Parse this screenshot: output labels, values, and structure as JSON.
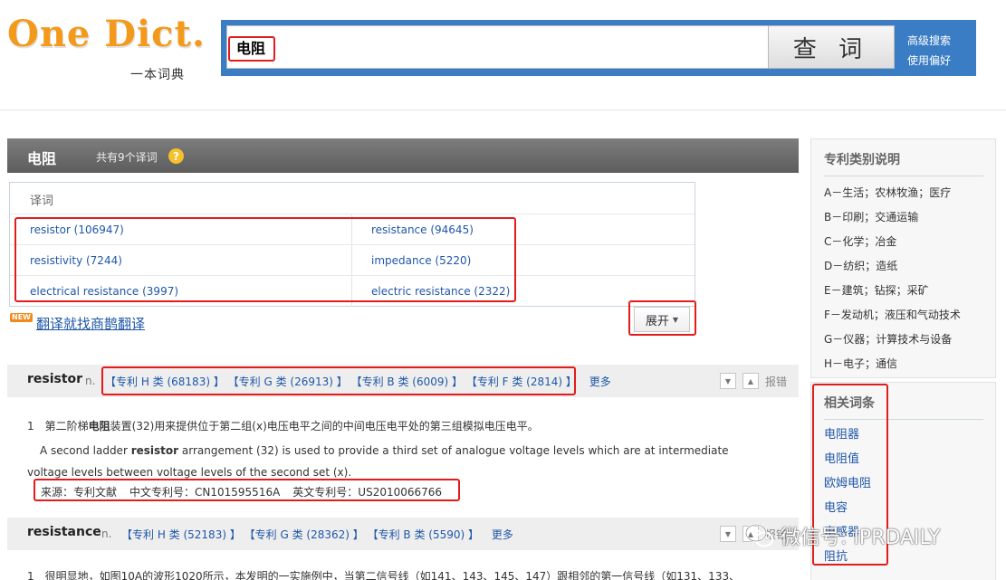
{
  "logo": {
    "main": "One Dict.",
    "sub": "一本词典"
  },
  "search": {
    "query": "电阻",
    "button_label": "查 词",
    "advanced": "高级搜索",
    "prefs": "使用偏好"
  },
  "word_panel": {
    "title": "电阻",
    "count_text": "共有9个译词",
    "help_icon": "?"
  },
  "translations": {
    "header": "译词",
    "rows": [
      {
        "left": "resistor (106947)",
        "right": "resistance (94645)"
      },
      {
        "left": "resistivity (7244)",
        "right": "impedance (5220)"
      },
      {
        "left": "electrical resistance (3997)",
        "right": "electric resistance (2322)"
      }
    ],
    "expand_label": "展开"
  },
  "promo": {
    "badge": "NEW",
    "text": "翻译就找商鹊翻译"
  },
  "entries": [
    {
      "word": "resistor",
      "pos": "n.",
      "categories": [
        "【专利 H 类 (68183) 】",
        "【专利 G 类 (26913) 】",
        "【专利 B 类 (6009) 】",
        "【专利 F 类 (2814) 】"
      ],
      "more": "更多",
      "report": "报错",
      "example": {
        "num": "1",
        "zh_pre": "第二阶梯",
        "zh_bold": "电阻",
        "zh_post": "装置(32)用来提供位于第二组(x)电压电平之间的中间电压电平处的第三组模拟电压电平。",
        "en_pre": "A second ladder ",
        "en_bold": "resistor",
        "en_post": " arrangement (32) is used to provide a third set of analogue voltage levels which are at intermediate voltage levels between voltage levels of the second set (x).",
        "source": "来源：专利文献",
        "cn_no": "中文专利号：CN101595516A",
        "en_no": "英文专利号：US2010066766"
      }
    },
    {
      "word": "resistance",
      "pos": "n.",
      "categories": [
        "【专利 H 类 (52183) 】",
        "【专利 G 类 (28362) 】",
        "【专利 B 类 (5590) 】"
      ],
      "more": "更多",
      "report": "报错",
      "example": {
        "num": "1",
        "zh": "很明显地，如图10A的波形1020所示，本发明的一实施例中，当第二信号线（如141、143、145、147）跟相邻的第一信号线（如131、133、"
      }
    }
  ],
  "sidebar": {
    "patent_title": "专利类别说明",
    "patent_items": [
      "A－生活；农林牧渔；医疗",
      "B－印刷；交通运输",
      "C－化学；冶金",
      "D－纺织；造纸",
      "E－建筑；钻探；采矿",
      "F－发动机；液压和气动技术",
      "G－仪器；计算技术与设备",
      "H－电子；通信"
    ],
    "related_title": "相关词条",
    "related_items": [
      "电阻器",
      "电阻值",
      "欧姆电阻",
      "电容",
      "电感器",
      "阻抗"
    ]
  },
  "watermark": "微信号: IPRDAILY",
  "colors": {
    "brand_orange": "#f39a1c",
    "search_blue": "#3b7dc4",
    "link_blue": "#1f57a8",
    "highlight_red": "#e21c1c"
  }
}
